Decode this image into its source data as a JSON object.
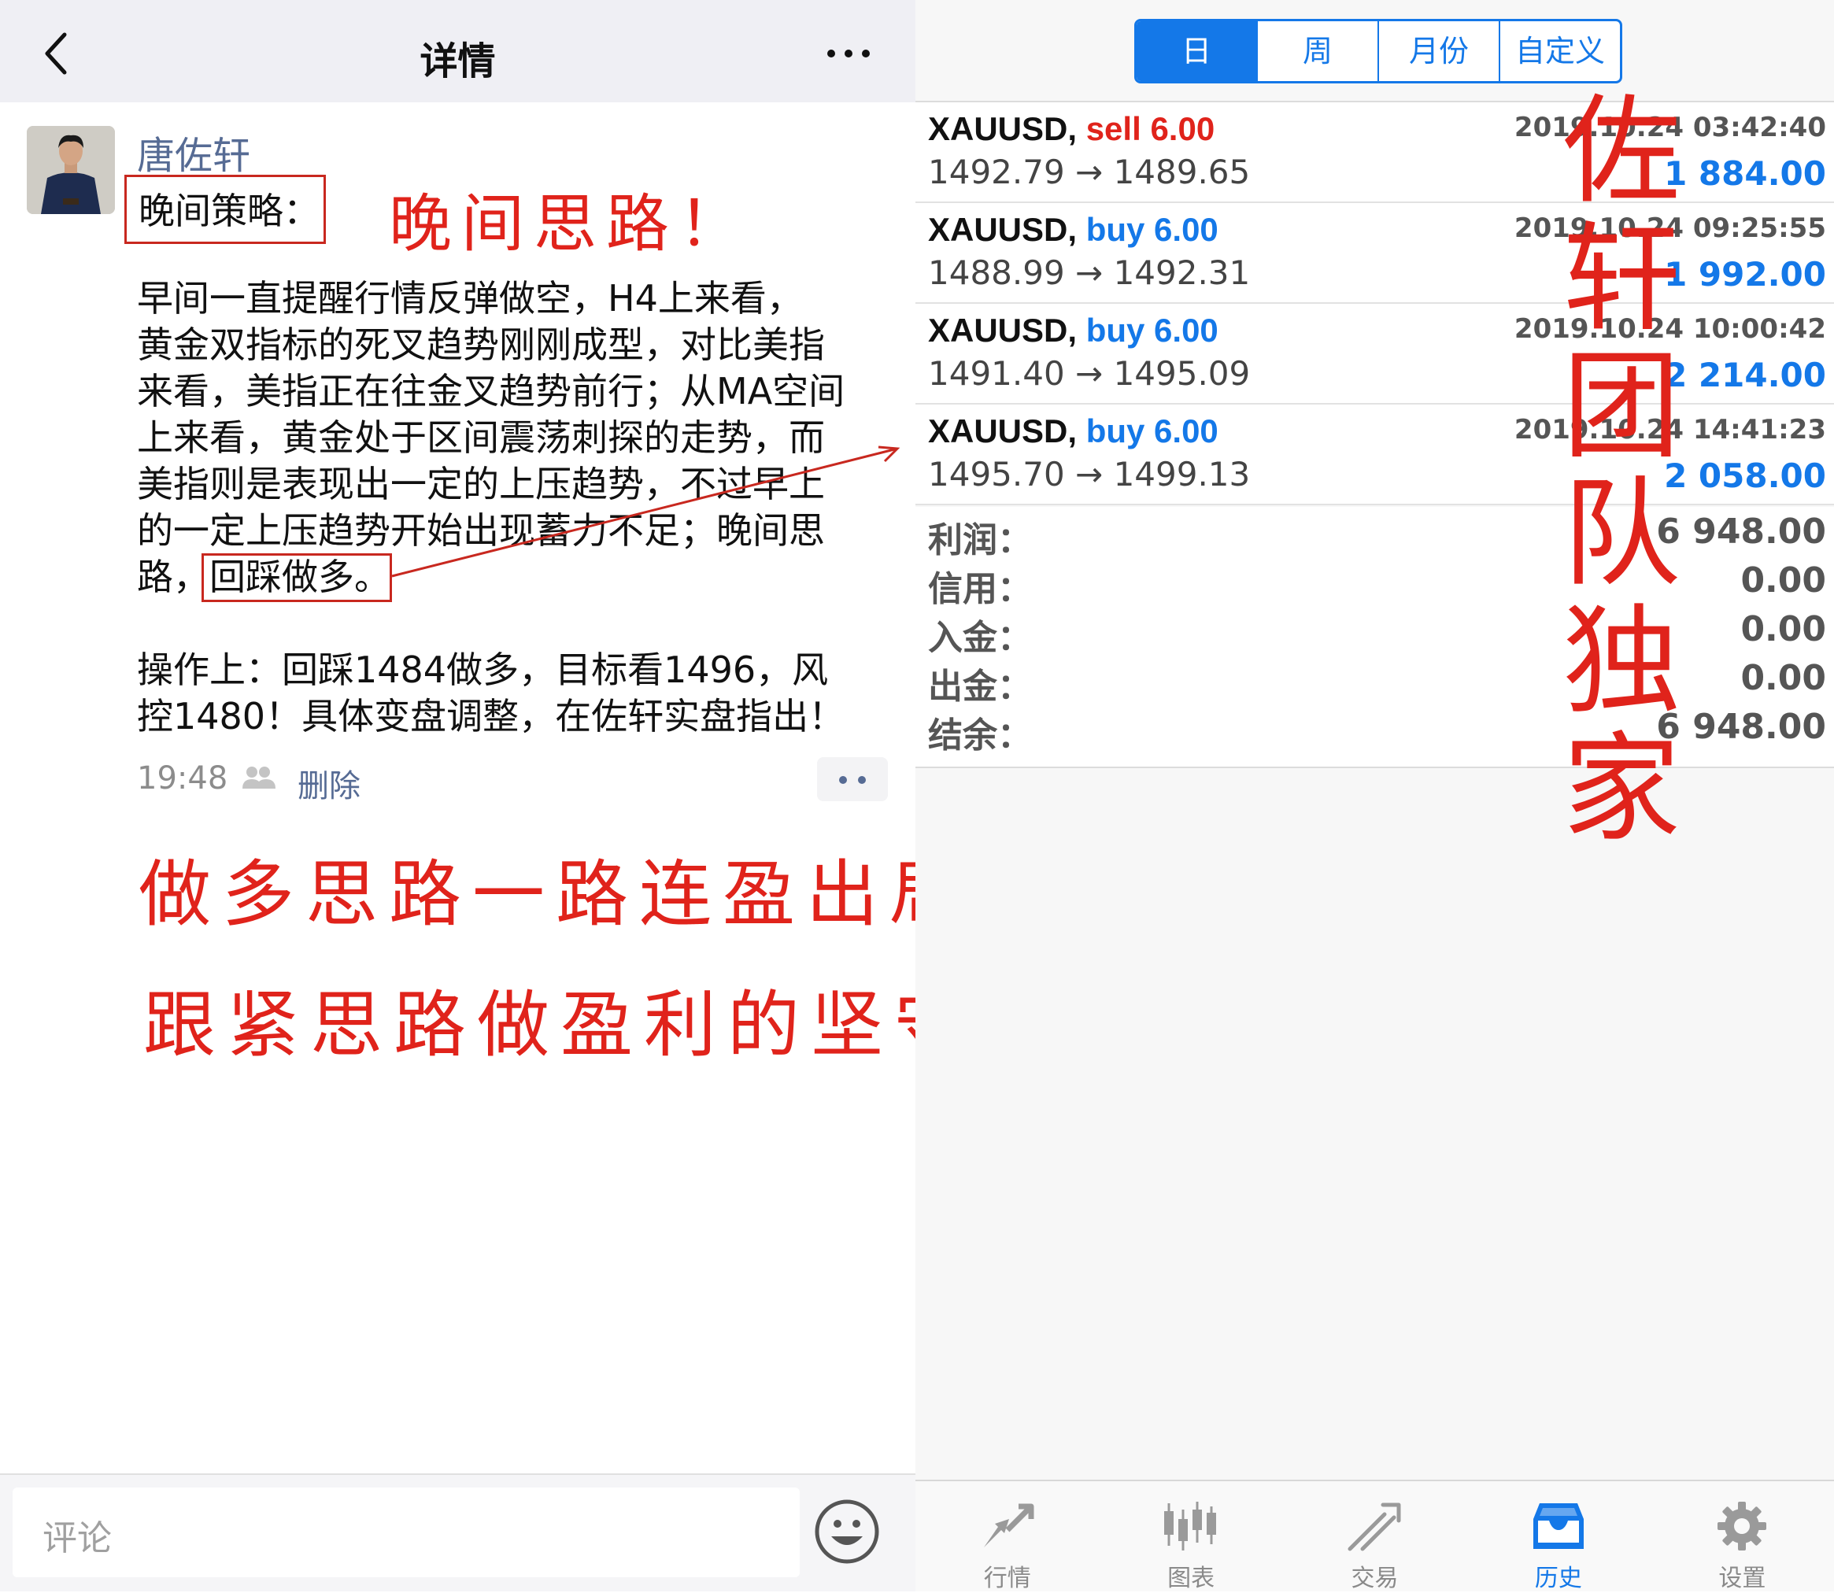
{
  "left": {
    "nav": {
      "title": "详情"
    },
    "post": {
      "author": "唐佐轩",
      "label": "晚间策略：",
      "annotation_title": "晚间思路！",
      "para1_lines": [
        "  早间一直提醒行情反弹做空，H4上来看，",
        "黄金双指标的死叉趋势刚刚成型，对比美指",
        "来看，美指正在往金叉趋势前行；从MA空间",
        "上来看，黄金处于区间震荡刺探的走势，而",
        "美指则是表现出一定的上压趋势，不过早上",
        "的一定上压趋势开始出现蓄力不足；晚间思",
        "路，回踩做多。"
      ],
      "para2_lines": [
        "  操作上：回踩1484做多，目标看1496，风",
        "控1480！具体变盘调整，在佐轩实盘指出！"
      ],
      "time": "19:48",
      "delete_label": "删除"
    },
    "annotations": [
      "做多思路一路连盈出局！",
      "跟紧思路做盈利的坚守者！"
    ],
    "comment": {
      "placeholder": "评论"
    }
  },
  "right": {
    "period_tabs": [
      {
        "label": "日",
        "active": true
      },
      {
        "label": "周",
        "active": false
      },
      {
        "label": "月份",
        "active": false
      },
      {
        "label": "自定义",
        "active": false
      }
    ],
    "deals": [
      {
        "symbol": "XAUUSD,",
        "side": "sell",
        "lots": "6.00",
        "side_color": "#e0231b",
        "date": "2019.10.24 03:42:40",
        "price": "1492.79 → 1489.65",
        "profit": "1 884.00"
      },
      {
        "symbol": "XAUUSD,",
        "side": "buy",
        "lots": "6.00",
        "side_color": "#1478e8",
        "date": "2019.10.24 09:25:55",
        "price": "1488.99 → 1492.31",
        "profit": "1 992.00"
      },
      {
        "symbol": "XAUUSD,",
        "side": "buy",
        "lots": "6.00",
        "side_color": "#1478e8",
        "date": "2019.10.24 10:00:42",
        "price": "1491.40 → 1495.09",
        "profit": "2 214.00"
      },
      {
        "symbol": "XAUUSD,",
        "side": "buy",
        "lots": "6.00",
        "side_color": "#1478e8",
        "date": "2019.10.24 14:41:23",
        "price": "1495.70 → 1499.13",
        "profit": "2 058.00"
      }
    ],
    "summary": [
      {
        "label": "利润：",
        "value": "6 948.00"
      },
      {
        "label": "信用：",
        "value": "0.00"
      },
      {
        "label": "入金：",
        "value": "0.00"
      },
      {
        "label": "出金：",
        "value": "0.00"
      },
      {
        "label": "结余：",
        "value": "6 948.00"
      }
    ],
    "vertical_annotation": [
      "佐",
      "轩",
      "团",
      "队",
      "独",
      "家"
    ],
    "tabbar": [
      {
        "label": "行情",
        "icon": "quotes-icon",
        "active": false
      },
      {
        "label": "图表",
        "icon": "chart-icon",
        "active": false
      },
      {
        "label": "交易",
        "icon": "trade-icon",
        "active": false
      },
      {
        "label": "历史",
        "icon": "history-icon",
        "active": true
      },
      {
        "label": "设置",
        "icon": "gear-icon",
        "active": false
      }
    ]
  },
  "colors": {
    "accent": "#1478e8",
    "annotation_red": "#e0231b",
    "link": "#566b94"
  }
}
